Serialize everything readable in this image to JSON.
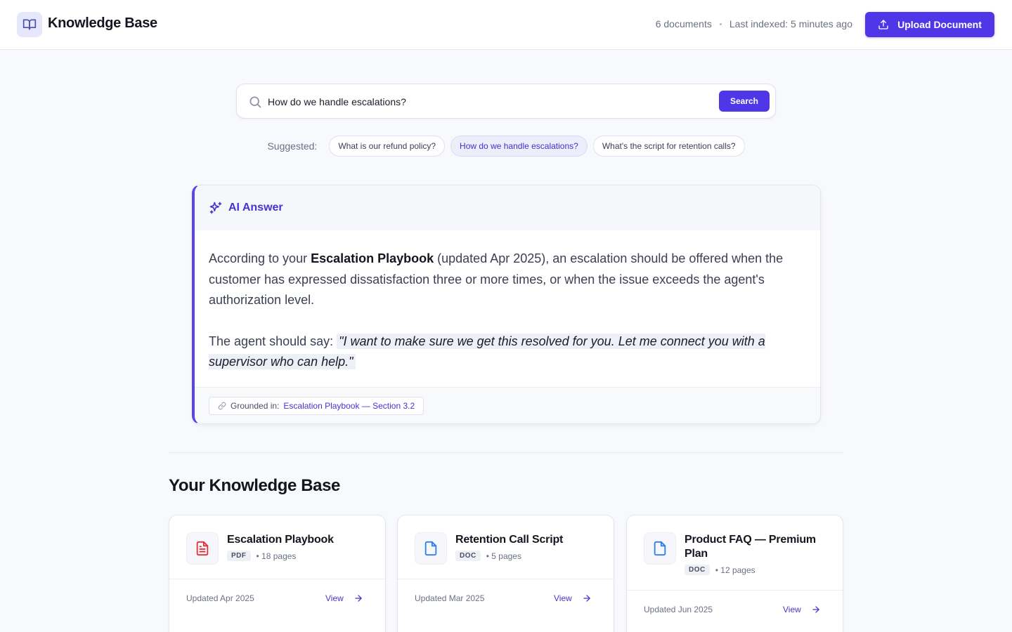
{
  "header": {
    "title": "Knowledge Base",
    "doc_count": "6 documents",
    "last_indexed": "Last indexed: 5 minutes ago",
    "upload_label": "Upload Document"
  },
  "search": {
    "value": "How do we handle escalations?",
    "button_label": "Search"
  },
  "suggestions": {
    "label": "Suggested:",
    "items": [
      {
        "text": "What is our refund policy?",
        "active": false
      },
      {
        "text": "How do we handle escalations?",
        "active": true
      },
      {
        "text": "What's the script for retention calls?",
        "active": false
      }
    ]
  },
  "answer": {
    "header": "AI Answer",
    "p1_before": "According to your ",
    "p1_bold": "Escalation Playbook",
    "p1_after": " (updated Apr 2025), an escalation should be offered when the customer has expressed dissatisfaction three or more times, or when the issue exceeds the agent's authorization level.",
    "p2_before": "The agent should say: ",
    "p2_quote": "\"I want to make sure we get this resolved for you. Let me connect you with a supervisor who can help.\"",
    "grounded_label": "Grounded in:",
    "grounded_source": "Escalation Playbook — Section 3.2"
  },
  "knowledge_base": {
    "title": "Your Knowledge Base",
    "documents": [
      {
        "name": "Escalation Playbook",
        "type": "PDF",
        "pages": "• 18 pages",
        "updated": "Updated Apr 2025",
        "view": "View",
        "icon": "pdf-file-icon"
      },
      {
        "name": "Retention Call Script",
        "type": "DOC",
        "pages": "• 5 pages",
        "updated": "Updated Mar 2025",
        "view": "View",
        "icon": "doc-file-icon"
      },
      {
        "name": "Product FAQ — Premium Plan",
        "type": "DOC",
        "pages": "• 12 pages",
        "updated": "Updated Jun 2025",
        "view": "View",
        "icon": "doc-file-icon"
      }
    ]
  },
  "colors": {
    "accent": "#5036e6",
    "pdf_icon": "#e0303f",
    "doc_icon": "#2f7df0"
  }
}
